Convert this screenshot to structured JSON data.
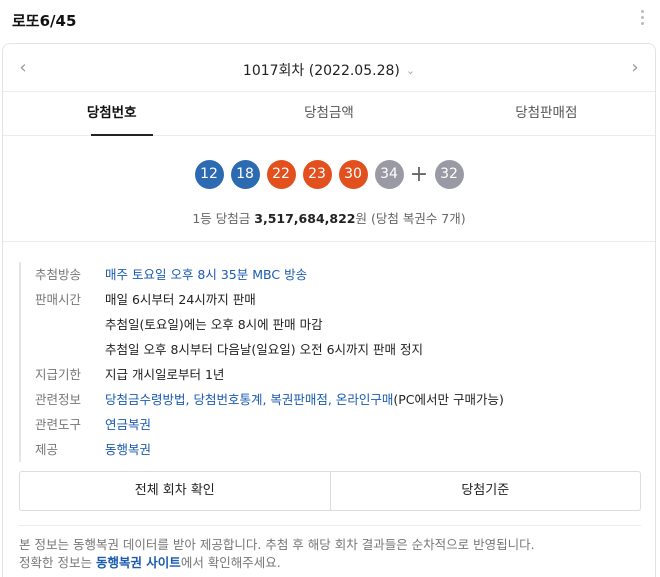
{
  "header": {
    "title": "로또6/45"
  },
  "round": {
    "label": "1017회차 (2022.05.28)"
  },
  "tabs": [
    "당첨번호",
    "당첨금액",
    "당첨판매점"
  ],
  "numbers": [
    {
      "value": "12",
      "color": "#2c6ab1"
    },
    {
      "value": "18",
      "color": "#2c6ab1"
    },
    {
      "value": "22",
      "color": "#e2501e"
    },
    {
      "value": "23",
      "color": "#e2501e"
    },
    {
      "value": "30",
      "color": "#e2501e"
    },
    {
      "value": "34",
      "color": "#9a9aa4"
    }
  ],
  "bonus": {
    "value": "32",
    "color": "#9a9aa4"
  },
  "prize": {
    "prefix": "1등 당첨금 ",
    "amount": "3,517,684,822",
    "suffix": "원 (당첨 복권수 7개)"
  },
  "info": {
    "draw_label": "추첨방송",
    "draw_value": "매주 토요일 오후 8시 35분 MBC 방송",
    "sale_label": "판매시간",
    "sale_value_1": "매일 6시부터 24시까지 판매",
    "sale_value_2": "추첨일(토요일)에는 오후 8시에 판매 마감",
    "sale_value_3": "추첨일 오후 8시부터 다음날(일요일) 오전 6시까지 판매 정지",
    "pay_label": "지급기한",
    "pay_value": "지급 개시일로부터 1년",
    "related_label": "관련정보",
    "related_links": "당첨금수령방법, 당첨번호통계, 복권판매점, 온라인구매",
    "related_note": "(PC에서만 구매가능)",
    "tool_label": "관련도구",
    "tool_value": "연금복권",
    "provider_label": "제공",
    "provider_value": "동행복권"
  },
  "buttons": {
    "all_rounds": "전체 회차 확인",
    "criteria": "당첨기준"
  },
  "notice": {
    "line1": "본 정보는 동행복권 데이터를 받아 제공합니다. 추첨 후 해당 회차 결과들은 순차적으로 반영됩니다.",
    "line2_prefix": "정확한 정보는 ",
    "line2_link": "동행복권 사이트",
    "line2_suffix": "에서 확인해주세요."
  },
  "icons": {
    "more": "more-vertical-icon",
    "prev": "chevron-left-icon",
    "next": "chevron-right-icon",
    "dropdown": "chevron-down-icon"
  }
}
